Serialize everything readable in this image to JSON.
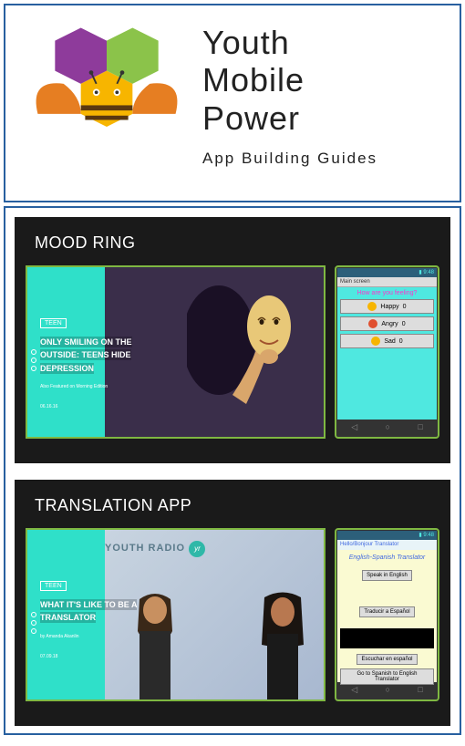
{
  "header": {
    "title_line1": "Youth",
    "title_line2": "Mobile",
    "title_line3": "Power",
    "subtitle": "App Building Guides"
  },
  "section1": {
    "title": "MOOD RING",
    "card": {
      "headline": "ONLY SMILING ON THE OUTSIDE: TEENS HIDE DEPRESSION",
      "meta": "Also Featured on Morning Edition",
      "date": "06.16.16"
    },
    "phone": {
      "time": "9:48",
      "actionbar": "Main screen",
      "prompt": "How are you feeling?",
      "rows": [
        {
          "label": "Happy",
          "count": "0"
        },
        {
          "label": "Angry",
          "count": "0"
        },
        {
          "label": "Sad",
          "count": "0"
        }
      ]
    }
  },
  "section2": {
    "title": "TRANSLATION APP",
    "card": {
      "headline": "WHAT IT'S LIKE TO BE A TRANSLATOR",
      "byline": "by Amanda Akanlin",
      "date": "07.09.18",
      "bg_text": "YOUTH RADIO"
    },
    "phone": {
      "time": "9:48",
      "actionbar": "Hello/Bonjour Translator",
      "title": "English-Spanish Translator",
      "btn1": "Speak in English",
      "btn2": "Traducir a Español",
      "btn3": "Escuchar en español",
      "btn4": "Go to Spanish to English Translator"
    }
  }
}
